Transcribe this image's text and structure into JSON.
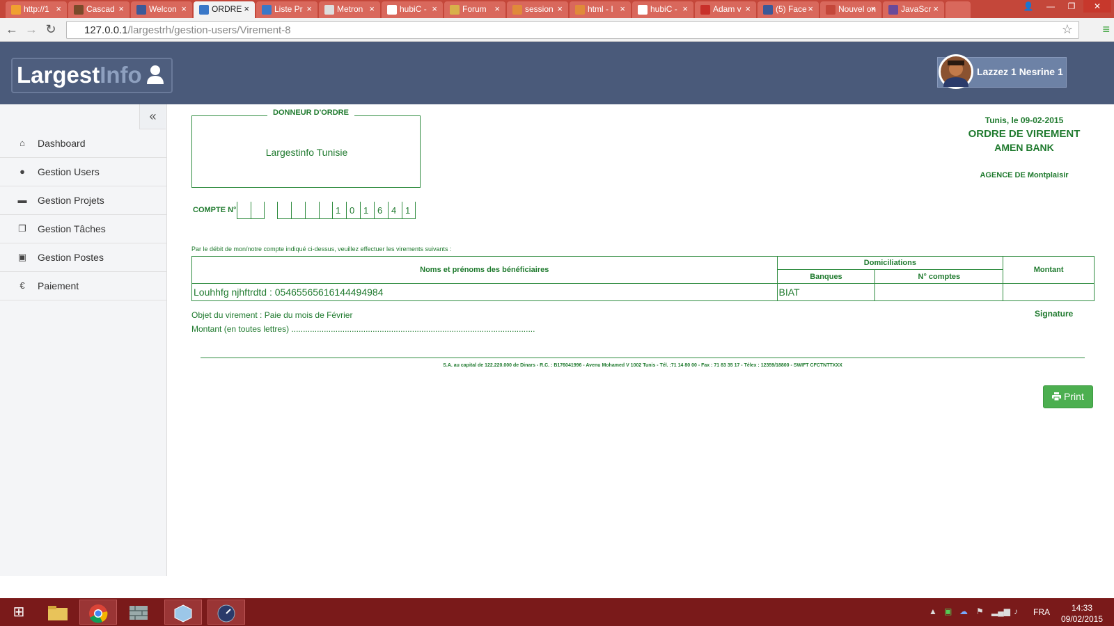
{
  "browser": {
    "tabs": [
      {
        "title": "http://1",
        "favicon_color": "#f0a030"
      },
      {
        "title": "Cascad",
        "favicon_color": "#7a4a2a"
      },
      {
        "title": "Welcon",
        "favicon_color": "#3b5998"
      },
      {
        "title": "ORDRE",
        "favicon_color": "#3a78c8",
        "active": true
      },
      {
        "title": "Liste Pr",
        "favicon_color": "#3a78c8"
      },
      {
        "title": "Metron",
        "favicon_color": "#dddddd"
      },
      {
        "title": "hubiC -",
        "favicon_color": "#ffffff"
      },
      {
        "title": "Forum",
        "favicon_color": "#d8b04a"
      },
      {
        "title": "session",
        "favicon_color": "#e08a3a"
      },
      {
        "title": "html - I",
        "favicon_color": "#e08a3a"
      },
      {
        "title": "hubiC -",
        "favicon_color": "#ffffff"
      },
      {
        "title": "Adam v",
        "favicon_color": "#c8302a"
      },
      {
        "title": "(5) Face",
        "favicon_color": "#3b5998"
      },
      {
        "title": "Nouvel on",
        "favicon_color": "#c4473a"
      },
      {
        "title": "JavaScr",
        "favicon_color": "#6a4a9a"
      }
    ],
    "tab_close": "×",
    "url_host": "127.0.0.1",
    "url_path": "/largestrh/gestion-users/Virement-8",
    "back": "←",
    "forward": "→",
    "reload": "↻",
    "star": "☆",
    "menu": "≡"
  },
  "window_controls": {
    "user": "👤",
    "minimize": "—",
    "maximize": "❐",
    "close": "✕"
  },
  "app": {
    "logo_main": "Largest",
    "logo_accent": "Info",
    "user_name": "Lazzez 1 Nesrine 1"
  },
  "sidebar": {
    "collapse": "«",
    "items": [
      {
        "label": "Dashboard",
        "icon": "home-icon",
        "glyph": "⌂"
      },
      {
        "label": "Gestion Users",
        "icon": "user-icon",
        "glyph": "●"
      },
      {
        "label": "Gestion Projets",
        "icon": "folder-icon",
        "glyph": "▬"
      },
      {
        "label": "Gestion Tâches",
        "icon": "copy-icon",
        "glyph": "❐"
      },
      {
        "label": "Gestion Postes",
        "icon": "briefcase-icon",
        "glyph": "▣"
      },
      {
        "label": "Paiement",
        "icon": "euro-icon",
        "glyph": "€"
      }
    ]
  },
  "ordre": {
    "donneur_label": "DONNEUR D'ORDRE",
    "donneur_value": "Largestinfo Tunisie",
    "compte_label": "COMPTE N°",
    "compte_digits": [
      "",
      "",
      "",
      "",
      "",
      "",
      "1",
      "0",
      "1",
      "6",
      "4",
      "1"
    ],
    "date_line": "Tunis, le 09-02-2015",
    "title": "ORDRE DE VIREMENT",
    "bank": "AMEN BANK",
    "agence": "AGENCE DE Montplaisir",
    "intro": "Par le débit de mon/notre compte indiqué ci-dessus, veuillez effectuer les virements suivants :",
    "table": {
      "col_names": "Noms et prénoms des bénéficiaires",
      "col_domiciliations": "Domiciliations",
      "col_banques": "Banques",
      "col_comptes": "N° comptes",
      "col_montant": "Montant",
      "row_name": "Louhhfg njhftrdtd : 05465565616144494984",
      "row_bank": "BIAT",
      "row_compte": "",
      "row_montant": ""
    },
    "objet": "Objet du virement : Paie du mois de Février",
    "montant_lettres": "Montant (en toutes lettres) .........................................................................................................",
    "signature": "Signature",
    "footer": "S.A. au capital de 122.220.000 de Dinars - R.C. : B176041996 - Avenu Mohamed V 1002 Tunis - Tél. :71 14 80 00 - Fax : 71 83 35 17 - Télex : 12359/18800 - SWIFT CFCTNTTXXX",
    "print_label": "Print"
  },
  "taskbar": {
    "start": "⊞",
    "lang": "FRA",
    "time": "14:33",
    "date": "09/02/2015"
  }
}
